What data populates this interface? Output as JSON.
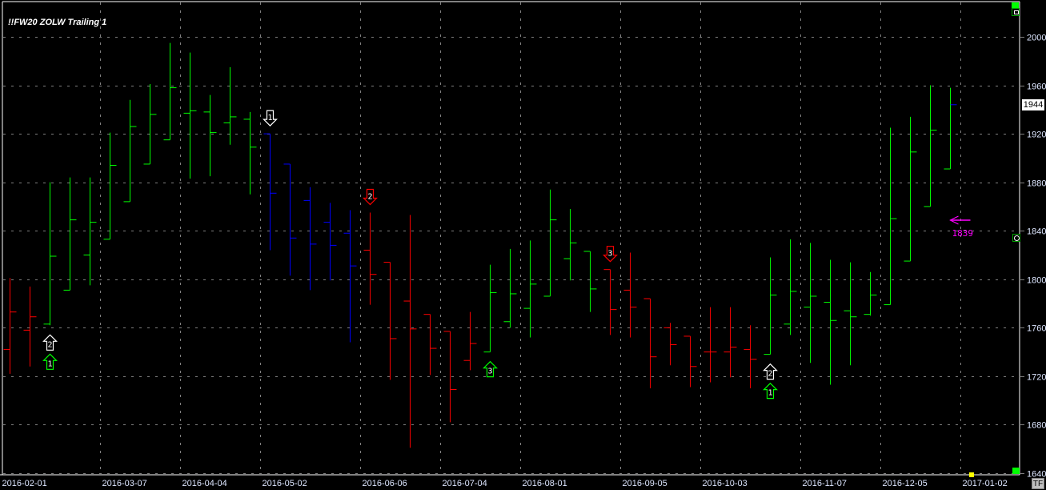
{
  "title": "!!FW20 ZOLW Trailing 1",
  "last_price_label": "1944",
  "tf_button": "TF",
  "colors": {
    "green": "#00ff00",
    "red": "#ff0000",
    "blue": "#0000ff",
    "white": "#ffffff",
    "magenta": "#ff00ff",
    "grid": "#808080",
    "axis_text": "#dde6ff"
  },
  "chart_data": {
    "type": "ohlc",
    "title": "!!FW20 ZOLW Trailing 1",
    "interval": "weekly",
    "first_week": "2016-02-01",
    "ylim": [
      1640,
      2000
    ],
    "yticks": [
      2000,
      1960,
      1920,
      1880,
      1840,
      1800,
      1760,
      1720,
      1680,
      1640
    ],
    "xticks": [
      {
        "week": 0,
        "label": "2016-02-01"
      },
      {
        "week": 5,
        "label": "2016-03-07"
      },
      {
        "week": 9,
        "label": "2016-04-04"
      },
      {
        "week": 13,
        "label": "2016-05-02"
      },
      {
        "week": 18,
        "label": "2016-06-06"
      },
      {
        "week": 22,
        "label": "2016-07-04"
      },
      {
        "week": 26,
        "label": "2016-08-01"
      },
      {
        "week": 31,
        "label": "2016-09-05"
      },
      {
        "week": 35,
        "label": "2016-10-03"
      },
      {
        "week": 40,
        "label": "2016-11-07"
      },
      {
        "week": 44,
        "label": "2016-12-05"
      },
      {
        "week": 48,
        "label": "2017-01-02"
      }
    ],
    "grid": true,
    "bars": [
      {
        "o": 1742,
        "h": 1801,
        "l": 1722,
        "c": 1773,
        "color": "red"
      },
      {
        "o": 1758,
        "h": 1794,
        "l": 1728,
        "c": 1769,
        "color": "red"
      },
      {
        "o": 1763,
        "h": 1880,
        "l": 1762,
        "c": 1819,
        "color": "green"
      },
      {
        "o": 1791,
        "h": 1884,
        "l": 1791,
        "c": 1849,
        "color": "green"
      },
      {
        "o": 1820,
        "h": 1884,
        "l": 1795,
        "c": 1847,
        "color": "green"
      },
      {
        "o": 1833,
        "h": 1921,
        "l": 1833,
        "c": 1894,
        "color": "green"
      },
      {
        "o": 1864,
        "h": 1948,
        "l": 1864,
        "c": 1926,
        "color": "green"
      },
      {
        "o": 1895,
        "h": 1961,
        "l": 1895,
        "c": 1936,
        "color": "green"
      },
      {
        "o": 1915,
        "h": 1995,
        "l": 1915,
        "c": 1958,
        "color": "green"
      },
      {
        "o": 1937,
        "h": 1987,
        "l": 1883,
        "c": 1939,
        "color": "green"
      },
      {
        "o": 1938,
        "h": 1952,
        "l": 1885,
        "c": 1921,
        "color": "green"
      },
      {
        "o": 1929,
        "h": 1975,
        "l": 1911,
        "c": 1934,
        "color": "green"
      },
      {
        "o": 1932,
        "h": 1938,
        "l": 1870,
        "c": 1909,
        "color": "green"
      },
      {
        "o": 1920,
        "h": 1920,
        "l": 1824,
        "c": 1871,
        "color": "blue"
      },
      {
        "o": 1895,
        "h": 1895,
        "l": 1803,
        "c": 1834,
        "color": "blue"
      },
      {
        "o": 1865,
        "h": 1876,
        "l": 1791,
        "c": 1829,
        "color": "blue"
      },
      {
        "o": 1847,
        "h": 1863,
        "l": 1799,
        "c": 1828,
        "color": "blue"
      },
      {
        "o": 1838,
        "h": 1857,
        "l": 1748,
        "c": 1811,
        "color": "blue"
      },
      {
        "o": 1824,
        "h": 1855,
        "l": 1779,
        "c": 1804,
        "color": "red"
      },
      {
        "o": 1814,
        "h": 1814,
        "l": 1717,
        "c": 1751,
        "color": "red"
      },
      {
        "o": 1782,
        "h": 1853,
        "l": 1661,
        "c": 1759,
        "color": "red"
      },
      {
        "o": 1771,
        "h": 1771,
        "l": 1721,
        "c": 1743,
        "color": "red"
      },
      {
        "o": 1757,
        "h": 1757,
        "l": 1682,
        "c": 1709,
        "color": "red"
      },
      {
        "o": 1733,
        "h": 1773,
        "l": 1725,
        "c": 1747,
        "color": "red"
      },
      {
        "o": 1740,
        "h": 1812,
        "l": 1740,
        "c": 1789,
        "color": "green"
      },
      {
        "o": 1765,
        "h": 1825,
        "l": 1760,
        "c": 1788,
        "color": "green"
      },
      {
        "o": 1776,
        "h": 1832,
        "l": 1752,
        "c": 1796,
        "color": "green"
      },
      {
        "o": 1786,
        "h": 1874,
        "l": 1786,
        "c": 1849,
        "color": "green"
      },
      {
        "o": 1817,
        "h": 1858,
        "l": 1799,
        "c": 1830,
        "color": "green"
      },
      {
        "o": 1823,
        "h": 1823,
        "l": 1773,
        "c": 1792,
        "color": "green"
      },
      {
        "o": 1808,
        "h": 1808,
        "l": 1754,
        "c": 1775,
        "color": "red"
      },
      {
        "o": 1791,
        "h": 1822,
        "l": 1752,
        "c": 1777,
        "color": "red"
      },
      {
        "o": 1784,
        "h": 1784,
        "l": 1710,
        "c": 1736,
        "color": "red"
      },
      {
        "o": 1760,
        "h": 1764,
        "l": 1729,
        "c": 1746,
        "color": "red"
      },
      {
        "o": 1753,
        "h": 1753,
        "l": 1711,
        "c": 1728,
        "color": "red"
      },
      {
        "o": 1740,
        "h": 1777,
        "l": 1715,
        "c": 1740,
        "color": "red"
      },
      {
        "o": 1740,
        "h": 1777,
        "l": 1719,
        "c": 1744,
        "color": "red"
      },
      {
        "o": 1742,
        "h": 1762,
        "l": 1710,
        "c": 1734,
        "color": "red"
      },
      {
        "o": 1738,
        "h": 1818,
        "l": 1738,
        "c": 1787,
        "color": "green"
      },
      {
        "o": 1763,
        "h": 1833,
        "l": 1754,
        "c": 1790,
        "color": "green"
      },
      {
        "o": 1777,
        "h": 1830,
        "l": 1731,
        "c": 1786,
        "color": "green"
      },
      {
        "o": 1781,
        "h": 1816,
        "l": 1713,
        "c": 1766,
        "color": "green"
      },
      {
        "o": 1774,
        "h": 1814,
        "l": 1729,
        "c": 1769,
        "color": "green"
      },
      {
        "o": 1771,
        "h": 1806,
        "l": 1770,
        "c": 1787,
        "color": "green"
      },
      {
        "o": 1779,
        "h": 1925,
        "l": 1779,
        "c": 1850,
        "color": "green"
      },
      {
        "o": 1815,
        "h": 1934,
        "l": 1815,
        "c": 1905,
        "color": "green"
      },
      {
        "o": 1860,
        "h": 1960,
        "l": 1860,
        "c": 1923,
        "color": "green"
      },
      {
        "o": 1891,
        "h": 1958,
        "l": 1891,
        "c": 1944,
        "color": "green",
        "close_color": "blue"
      }
    ],
    "signals": [
      {
        "bar": 2,
        "dir": "up",
        "label": "2",
        "color": "white",
        "stack": 0
      },
      {
        "bar": 2,
        "dir": "up",
        "label": "1",
        "color": "green",
        "stack": 1
      },
      {
        "bar": 13,
        "dir": "down",
        "label": "1",
        "color": "white",
        "stack": 0
      },
      {
        "bar": 18,
        "dir": "down",
        "label": "2",
        "color": "red",
        "stack": 0
      },
      {
        "bar": 24,
        "dir": "up",
        "label": "3",
        "color": "green",
        "stack": 0
      },
      {
        "bar": 30,
        "dir": "down",
        "label": "3",
        "color": "red",
        "stack": 0
      },
      {
        "bar": 38,
        "dir": "up",
        "label": "2",
        "color": "white",
        "stack": 0
      },
      {
        "bar": 38,
        "dir": "up",
        "label": "1",
        "color": "green",
        "stack": 1
      }
    ],
    "stop_marker": {
      "week": 47,
      "price": 1849,
      "label": "1839"
    },
    "last_price": 1944
  }
}
